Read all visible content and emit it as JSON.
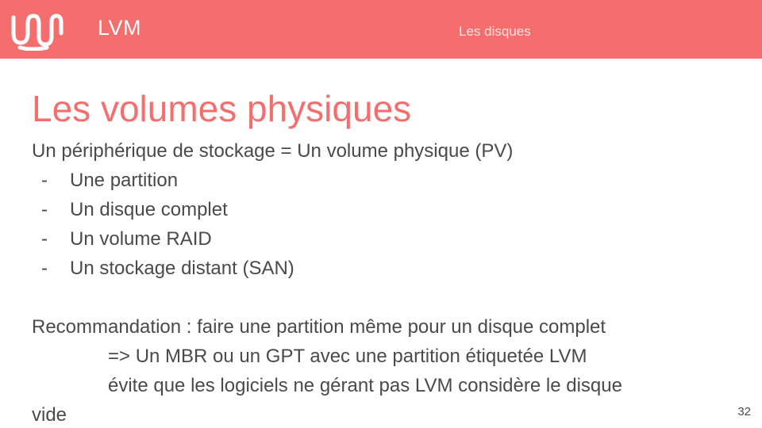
{
  "header": {
    "title": "LVM",
    "section": "Les disques"
  },
  "slide": {
    "title": "Les volumes physiques",
    "intro": "Un périphérique de stockage = Un volume physique (PV)",
    "bullets": [
      "Une partition",
      "Un disque complet",
      "Un volume RAID",
      "Un stockage distant (SAN)"
    ],
    "bullet_marker": "-",
    "recommendation": "Recommandation : faire une partition même pour un disque complet",
    "detail_1": "=> Un MBR ou un GPT avec une partition étiquetée LVM",
    "detail_2": "évite que les logiciels ne gérant pas LVM considère le disque",
    "detail_2_wrap": "vide"
  },
  "page_number": "32",
  "colors": {
    "accent": "#f46e6e",
    "text": "#4a4a4a",
    "header_text": "#ffffff"
  },
  "icons": {
    "logo": "wave-logo-icon"
  }
}
